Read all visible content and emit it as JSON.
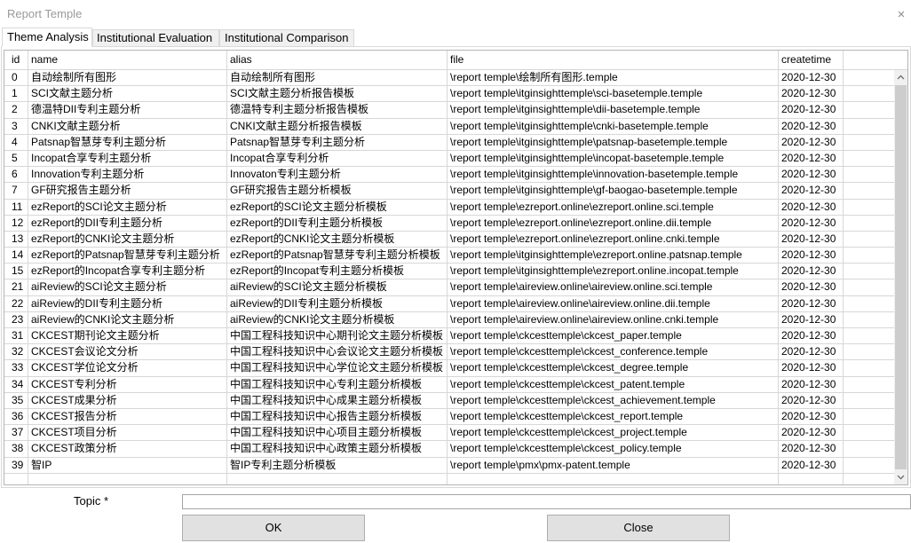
{
  "window": {
    "title": "Report Temple",
    "close_icon": "close-icon"
  },
  "tabs": [
    {
      "label": "Theme Analysis",
      "selected": true
    },
    {
      "label": "Institutional Evaluation",
      "selected": false
    },
    {
      "label": "Institutional Comparison",
      "selected": false
    }
  ],
  "table": {
    "columns": [
      "id",
      "name",
      "alias",
      "file",
      "createtime"
    ],
    "rows": [
      {
        "id": "0",
        "name": "自动绘制所有图形",
        "alias": "自动绘制所有图形",
        "file": "\\report temple\\绘制所有图形.temple",
        "createtime": "2020-12-30"
      },
      {
        "id": "1",
        "name": "SCI文献主题分析",
        "alias": "SCI文献主题分析报告模板",
        "file": "\\report temple\\itginsighttemple\\sci-basetemple.temple",
        "createtime": "2020-12-30"
      },
      {
        "id": "2",
        "name": "德温特DII专利主题分析",
        "alias": "德温特专利主题分析报告模板",
        "file": "\\report temple\\itginsighttemple\\dii-basetemple.temple",
        "createtime": "2020-12-30"
      },
      {
        "id": "3",
        "name": "CNKI文献主题分析",
        "alias": "CNKI文献主题分析报告模板",
        "file": "\\report temple\\itginsighttemple\\cnki-basetemple.temple",
        "createtime": "2020-12-30"
      },
      {
        "id": "4",
        "name": "Patsnap智慧芽专利主题分析",
        "alias": "Patsnap智慧芽专利主题分析",
        "file": "\\report temple\\itginsighttemple\\patsnap-basetemple.temple",
        "createtime": "2020-12-30"
      },
      {
        "id": "5",
        "name": "Incopat合享专利主题分析",
        "alias": "Incopat合享专利分析",
        "file": "\\report temple\\itginsighttemple\\incopat-basetemple.temple",
        "createtime": "2020-12-30"
      },
      {
        "id": "6",
        "name": "Innovation专利主题分析",
        "alias": "Innovaton专利主题分析",
        "file": "\\report temple\\itginsighttemple\\innovation-basetemple.temple",
        "createtime": "2020-12-30"
      },
      {
        "id": "7",
        "name": "GF研究报告主题分析",
        "alias": "GF研究报告主题分析模板",
        "file": "\\report temple\\itginsighttemple\\gf-baogao-basetemple.temple",
        "createtime": "2020-12-30"
      },
      {
        "id": "11",
        "name": "ezReport的SCI论文主题分析",
        "alias": "ezReport的SCI论文主题分析模板",
        "file": "\\report temple\\ezreport.online\\ezreport.online.sci.temple",
        "createtime": "2020-12-30"
      },
      {
        "id": "12",
        "name": "ezReport的DII专利主题分析",
        "alias": "ezReport的DII专利主题分析模板",
        "file": "\\report temple\\ezreport.online\\ezreport.online.dii.temple",
        "createtime": "2020-12-30"
      },
      {
        "id": "13",
        "name": "ezReport的CNKI论文主题分析",
        "alias": "ezReport的CNKI论文主题分析模板",
        "file": "\\report temple\\ezreport.online\\ezreport.online.cnki.temple",
        "createtime": "2020-12-30"
      },
      {
        "id": "14",
        "name": "ezReport的Patsnap智慧芽专利主题分析",
        "alias": "ezReport的Patsnap智慧芽专利主题分析模板",
        "file": "\\report temple\\itginsighttemple\\ezreport.online.patsnap.temple",
        "createtime": "2020-12-30"
      },
      {
        "id": "15",
        "name": "ezReport的Incopat合享专利主题分析",
        "alias": "ezReport的Incopat专利主题分析模板",
        "file": "\\report temple\\itginsighttemple\\ezreport.online.incopat.temple",
        "createtime": "2020-12-30"
      },
      {
        "id": "21",
        "name": "aiReview的SCI论文主题分析",
        "alias": "aiReview的SCI论文主题分析模板",
        "file": "\\report temple\\aireview.online\\aireview.online.sci.temple",
        "createtime": "2020-12-30"
      },
      {
        "id": "22",
        "name": "aiReview的DII专利主题分析",
        "alias": "aiReview的DII专利主题分析模板",
        "file": "\\report temple\\aireview.online\\aireview.online.dii.temple",
        "createtime": "2020-12-30"
      },
      {
        "id": "23",
        "name": "aiReview的CNKI论文主题分析",
        "alias": "aiReview的CNKI论文主题分析模板",
        "file": "\\report temple\\aireview.online\\aireview.online.cnki.temple",
        "createtime": "2020-12-30"
      },
      {
        "id": "31",
        "name": "CKCEST期刊论文主题分析",
        "alias": "中国工程科技知识中心期刊论文主题分析模板",
        "file": "\\report temple\\ckcesttemple\\ckcest_paper.temple",
        "createtime": "2020-12-30"
      },
      {
        "id": "32",
        "name": "CKCEST会议论文分析",
        "alias": "中国工程科技知识中心会议论文主题分析模板",
        "file": "\\report temple\\ckcesttemple\\ckcest_conference.temple",
        "createtime": "2020-12-30"
      },
      {
        "id": "33",
        "name": "CKCEST学位论文分析",
        "alias": "中国工程科技知识中心学位论文主题分析模板",
        "file": "\\report temple\\ckcesttemple\\ckcest_degree.temple",
        "createtime": "2020-12-30"
      },
      {
        "id": "34",
        "name": "CKCEST专利分析",
        "alias": "中国工程科技知识中心专利主题分析模板",
        "file": "\\report temple\\ckcesttemple\\ckcest_patent.temple",
        "createtime": "2020-12-30"
      },
      {
        "id": "35",
        "name": "CKCEST成果分析",
        "alias": "中国工程科技知识中心成果主题分析模板",
        "file": "\\report temple\\ckcesttemple\\ckcest_achievement.temple",
        "createtime": "2020-12-30"
      },
      {
        "id": "36",
        "name": "CKCEST报告分析",
        "alias": "中国工程科技知识中心报告主题分析模板",
        "file": "\\report temple\\ckcesttemple\\ckcest_report.temple",
        "createtime": "2020-12-30"
      },
      {
        "id": "37",
        "name": "CKCEST项目分析",
        "alias": "中国工程科技知识中心项目主题分析模板",
        "file": "\\report temple\\ckcesttemple\\ckcest_project.temple",
        "createtime": "2020-12-30"
      },
      {
        "id": "38",
        "name": "CKCEST政策分析",
        "alias": "中国工程科技知识中心政策主题分析模板",
        "file": "\\report temple\\ckcesttemple\\ckcest_policy.temple",
        "createtime": "2020-12-30"
      },
      {
        "id": "39",
        "name": "智IP",
        "alias": "智IP专利主题分析模板",
        "file": "\\report temple\\pmx\\pmx-patent.temple",
        "createtime": "2020-12-30"
      }
    ]
  },
  "scrollbar": {
    "up_icon": "chevron-up-icon",
    "down_icon": "chevron-down-icon"
  },
  "topic": {
    "label": "Topic *",
    "value": ""
  },
  "buttons": {
    "ok": "OK",
    "close": "Close"
  },
  "colors": {
    "title_text": "#9a9a9a",
    "grid_line": "#d7d7d7",
    "tab_inactive_bg": "#f0f0f0",
    "button_bg": "#e1e1e1",
    "button_border": "#adadad",
    "scroll_thumb": "#cdcdcd"
  }
}
